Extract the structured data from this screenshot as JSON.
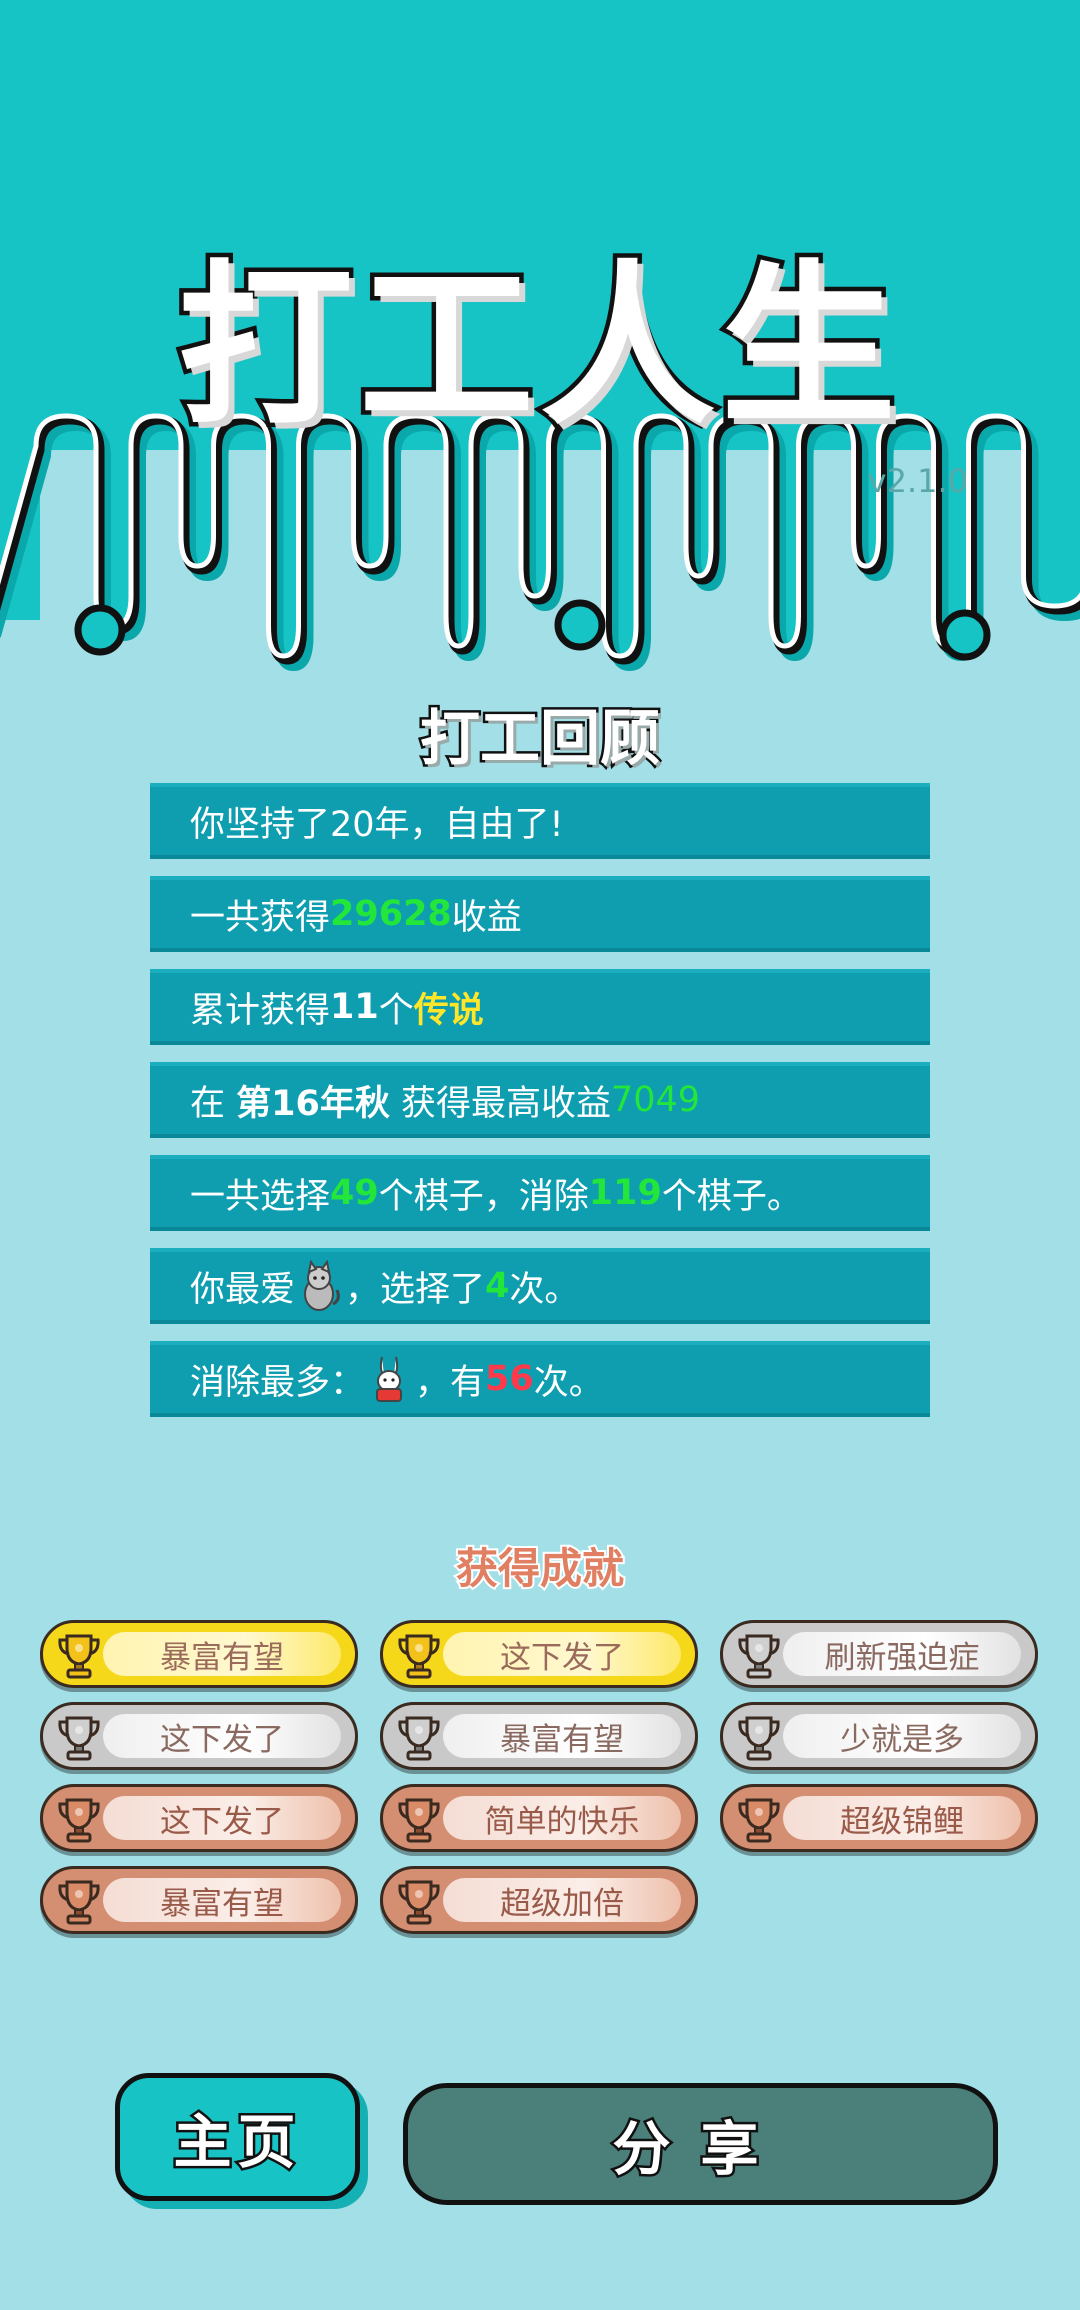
{
  "app": {
    "title": "打工人生",
    "version": "v2.1.0",
    "header_color": "#16c4c6",
    "background_color": "#a3dfe6"
  },
  "review": {
    "title": "打工回顾",
    "rows": [
      {
        "parts": [
          {
            "text": "你坚持了20年，自由了!",
            "style": ""
          }
        ]
      },
      {
        "parts": [
          {
            "text": "一共获得",
            "style": ""
          },
          {
            "text": "29628",
            "style": "green"
          },
          {
            "text": "收益",
            "style": ""
          }
        ]
      },
      {
        "parts": [
          {
            "text": "累计获得",
            "style": ""
          },
          {
            "text": "11",
            "style": "bold"
          },
          {
            "text": "个",
            "style": ""
          },
          {
            "text": "传说",
            "style": "yellow"
          }
        ]
      },
      {
        "parts": [
          {
            "text": "在 ",
            "style": ""
          },
          {
            "text": "第16年秋",
            "style": "bold"
          },
          {
            "text": " 获得最高收益",
            "style": ""
          },
          {
            "text": "7049",
            "style": "green-thin"
          }
        ]
      },
      {
        "parts": [
          {
            "text": "一共选择",
            "style": ""
          },
          {
            "text": "49",
            "style": "green"
          },
          {
            "text": "个棋子，消除",
            "style": ""
          },
          {
            "text": "119",
            "style": "green"
          },
          {
            "text": "个棋子。",
            "style": ""
          }
        ]
      },
      {
        "parts": [
          {
            "text": "你最爱",
            "style": ""
          },
          {
            "icon": "cat-icon"
          },
          {
            "text": "，选择了",
            "style": ""
          },
          {
            "text": "4",
            "style": "green"
          },
          {
            "text": "次。",
            "style": ""
          }
        ]
      },
      {
        "parts": [
          {
            "text": "消除最多：",
            "style": ""
          },
          {
            "icon": "rabbit-icon"
          },
          {
            "text": "，有",
            "style": ""
          },
          {
            "text": "56",
            "style": "red"
          },
          {
            "text": "次。",
            "style": ""
          }
        ]
      }
    ]
  },
  "achievements": {
    "title": "获得成就",
    "items": [
      {
        "label": "暴富有望",
        "tier": "gold"
      },
      {
        "label": "这下发了",
        "tier": "gold"
      },
      {
        "label": "刷新强迫症",
        "tier": "silver"
      },
      {
        "label": "这下发了",
        "tier": "silver"
      },
      {
        "label": "暴富有望",
        "tier": "silver"
      },
      {
        "label": "少就是多",
        "tier": "silver"
      },
      {
        "label": "这下发了",
        "tier": "bronze"
      },
      {
        "label": "简单的快乐",
        "tier": "bronze"
      },
      {
        "label": "超级锦鲤",
        "tier": "bronze"
      },
      {
        "label": "暴富有望",
        "tier": "bronze"
      },
      {
        "label": "超级加倍",
        "tier": "bronze"
      }
    ]
  },
  "buttons": {
    "home": "主页",
    "share": "分享"
  }
}
